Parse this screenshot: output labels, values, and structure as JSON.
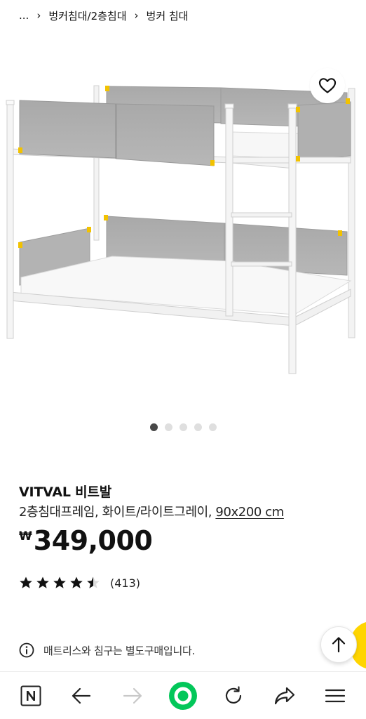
{
  "breadcrumb": {
    "ellipsis": "...",
    "items": [
      "벙커침대/2층침대",
      "벙커 침대"
    ],
    "separator": "›"
  },
  "gallery": {
    "image_icon": "bunk-bed-product-image",
    "dots_total": 5,
    "dots_active": 1
  },
  "product": {
    "name": "VITVAL 비트발",
    "description": "2층침대프레임, 화이트/라이트그레이, ",
    "size": "90x200 cm",
    "currency_symbol": "₩",
    "price": "349,000",
    "rating": 4.5,
    "rating_max": 5,
    "review_count": "(413)"
  },
  "notice": {
    "icon": "info-icon",
    "text": "매트리스와 침구는 별도구매입니다."
  },
  "colors": {
    "accent_yellow": "#ffd500",
    "dot_active": "#484848",
    "dot_inactive": "#dfdfdf",
    "browser_green": "#03c75a"
  },
  "browser_nav": {
    "buttons": [
      "naver-home-icon",
      "back-arrow-icon",
      "forward-arrow-icon",
      "green-home-icon",
      "refresh-icon",
      "share-icon",
      "menu-icon"
    ]
  }
}
